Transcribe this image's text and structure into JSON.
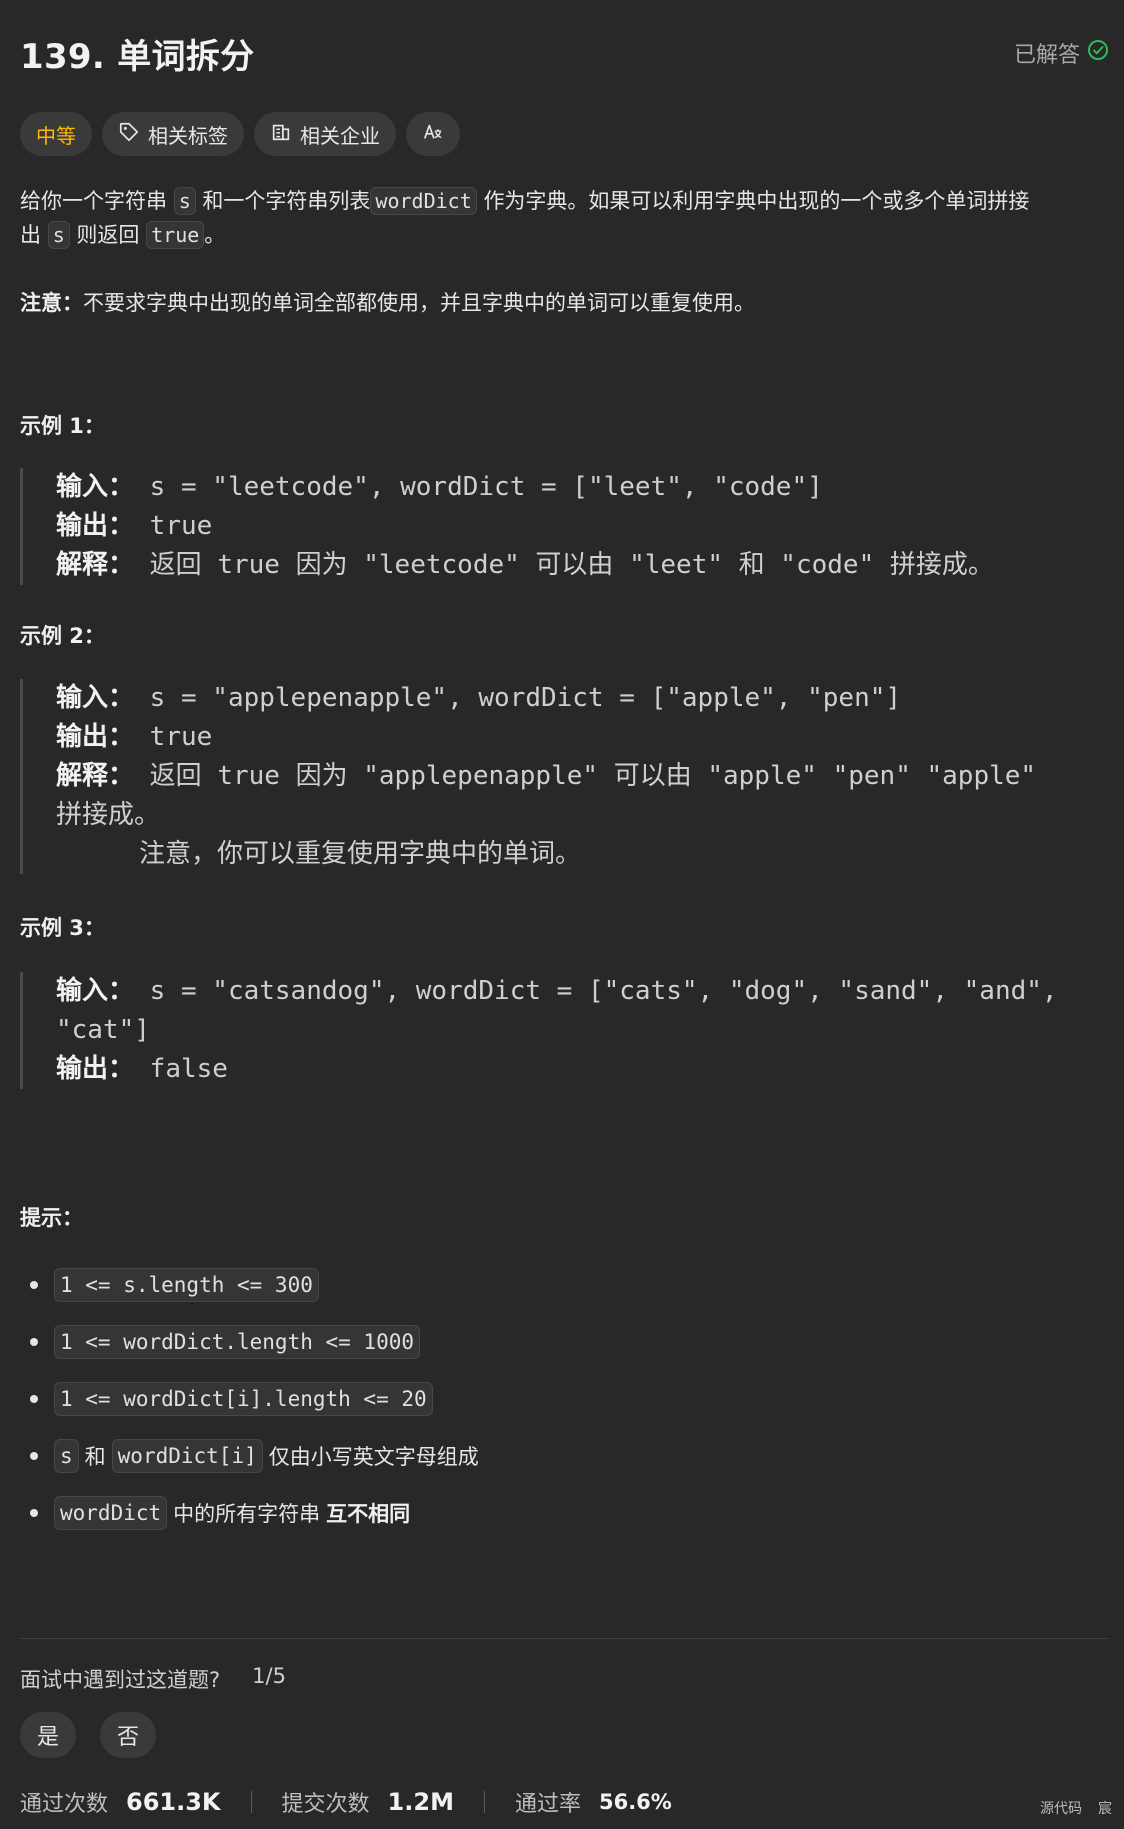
{
  "header": {
    "title": "139. 单词拆分",
    "status": "已解答"
  },
  "tags": [
    {
      "label": "中等"
    },
    {
      "label": "相关标签",
      "icon": "tag-icon"
    },
    {
      "label": "相关企业",
      "icon": "building-icon"
    },
    {
      "label": "",
      "icon": "translate-icon"
    }
  ],
  "description": {
    "p1_a": "给你一个字符串",
    "p1_s": "s",
    "p1_b": "和一个字符串列表",
    "p1_wd": "wordDict",
    "p1_c": "作为字典。如果可以利用字典中出现的一个或多个单词拼接",
    "p1_d": "出",
    "p1_s2": "s",
    "p1_e": "则返回",
    "p1_true": "true",
    "p1_f": "。",
    "note_label": "注意：",
    "note_text": "不要求字典中出现的单词全部都使用，并且字典中的单词可以重复使用。"
  },
  "examples": [
    {
      "title": "示例 1：",
      "input_label": "输入：",
      "input": "s = \"leetcode\", wordDict = [\"leet\", \"code\"]",
      "output_label": "输出：",
      "output": "true",
      "explain_label": "解释：",
      "explain": "返回 true 因为 \"leetcode\" 可以由 \"leet\" 和 \"code\" 拼接成。"
    },
    {
      "title": "示例 2：",
      "input_label": "输入：",
      "input": "s = \"applepenapple\", wordDict = [\"apple\", \"pen\"]",
      "output_label": "输出：",
      "output": "true",
      "explain_label": "解释：",
      "explain_1": "返回 true 因为 \"applepenapple\" 可以由 \"apple\" \"pen\" \"apple\"",
      "explain_2": "拼接成。",
      "explain_3": "注意，你可以重复使用字典中的单词。"
    },
    {
      "title": "示例 3：",
      "input_label": "输入：",
      "input_1": "s = \"catsandog\", wordDict = [\"cats\", \"dog\", \"sand\", \"and\",",
      "input_2": "\"cat\"]",
      "output_label": "输出：",
      "output": "false"
    }
  ],
  "hints": {
    "title": "提示：",
    "c1": "1 <= s.length <= 300",
    "c2": "1 <= wordDict.length <= 1000",
    "c3": "1 <= wordDict[i].length <= 20",
    "c4_a": "s",
    "c4_b": "和",
    "c4_c": "wordDict[i]",
    "c4_d": "仅由小写英文字母组成",
    "c5_a": "wordDict",
    "c5_b": "中的所有字符串",
    "c5_c": "互不相同"
  },
  "interview": {
    "question": "面试中遇到过这道题?",
    "count": "1/5",
    "yes": "是",
    "no": "否"
  },
  "stats": {
    "accepted_label": "通过次数",
    "accepted": "661.3K",
    "submissions_label": "提交次数",
    "submissions": "1.2M",
    "rate_label": "通过率",
    "rate": "56.6%"
  },
  "corner": {
    "source": "源代码",
    "extra": "宸"
  },
  "colors": {
    "medium": "#ffb800",
    "solved": "#2cbb5d",
    "background": "#282828"
  }
}
